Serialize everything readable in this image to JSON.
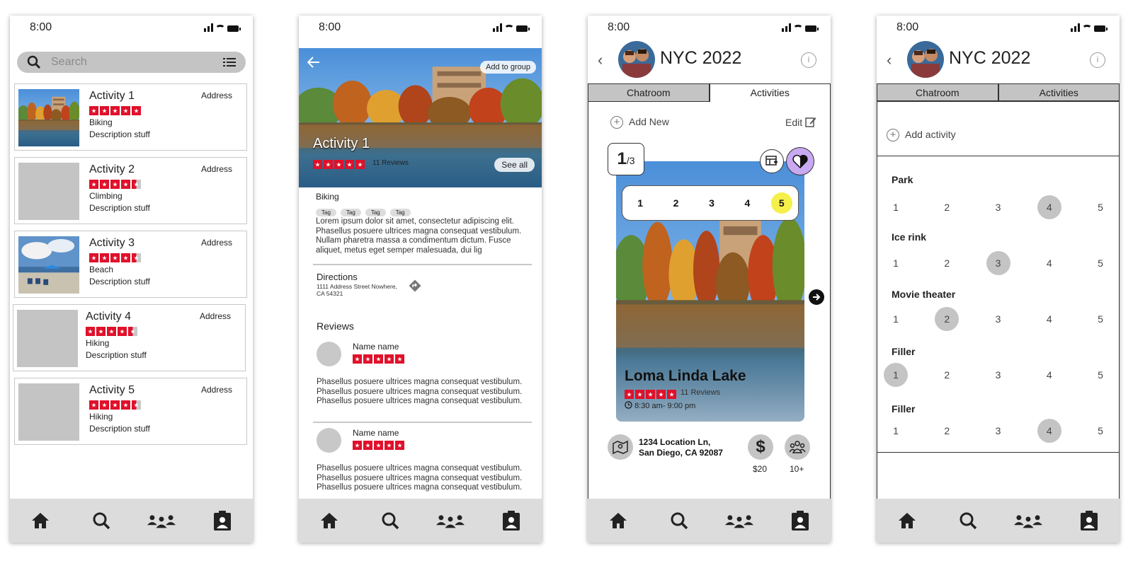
{
  "status": {
    "time": "8:00"
  },
  "search_screen": {
    "search_placeholder": "Search",
    "activities": [
      {
        "title": "Activity 1",
        "rating": 5,
        "category": "Biking",
        "description": "Description stuff",
        "address": "Address",
        "image": "lake"
      },
      {
        "title": "Activity 2",
        "rating": 4.5,
        "category": "Climbing",
        "description": "Description stuff",
        "address": "Address",
        "image": "none"
      },
      {
        "title": "Activity 3",
        "rating": 4.5,
        "category": "Beach",
        "description": "Description stuff",
        "address": "Address",
        "image": "beach"
      },
      {
        "title": "Activity 4",
        "rating": 4.5,
        "category": "Hiking",
        "description": "Description stuff",
        "address": "Address",
        "image": "none"
      },
      {
        "title": "Activity 5",
        "rating": 4.5,
        "category": "Hiking",
        "description": "Description stuff",
        "address": "Address",
        "image": "none"
      }
    ]
  },
  "detail_screen": {
    "add_to_group": "Add to group",
    "title": "Activity 1",
    "reviews_count": "11 Reviews",
    "see_all": "See all",
    "category": "Biking",
    "tags": [
      "Tag",
      "Tag",
      "Tag",
      "Tag"
    ],
    "description": "Lorem ipsum dolor sit amet, consectetur adipiscing elit. Phasellus posuere ultrices magna consequat vestibulum. Nullam pharetra massa a condimentum dictum. Fusce aliquet, metus eget semper malesuada, dui lig",
    "directions_label": "Directions",
    "address_line1": "1111 Address Street Nowhere,",
    "address_line2": "CA 54321",
    "reviews_label": "Reviews",
    "reviews": [
      {
        "name": "Name name",
        "text": "Phasellus posuere ultrices magna consequat vestibulum. Phasellus posuere ultrices magna consequat vestibulum. Phasellus posuere ultrices magna consequat vestibulum."
      },
      {
        "name": "Name name",
        "text": "Phasellus posuere ultrices magna consequat vestibulum. Phasellus posuere ultrices magna consequat vestibulum. Phasellus posuere ultrices magna consequat vestibulum."
      }
    ]
  },
  "group_screen": {
    "group_name": "NYC 2022",
    "info": "i",
    "tab_chatroom": "Chatroom",
    "tab_activities": "Activities",
    "add_new": "Add New",
    "edit": "Edit",
    "counter_current": "1",
    "counter_total": "/3",
    "rank_options": [
      "1",
      "2",
      "3",
      "4",
      "5"
    ],
    "selected_rank": "5",
    "place_name": "Loma Linda Lake",
    "place_reviews": "11 Reviews",
    "hours": "8:30 am- 9:00 pm",
    "location_line1": "1234 Location Ln,",
    "location_line2": "San Diego, CA 92087",
    "price_symbol": "$",
    "price": "$20",
    "group_size": "10+"
  },
  "ranking_screen": {
    "group_name": "NYC 2022",
    "tab_chatroom": "Chatroom",
    "tab_activities": "Activities",
    "add_activity": "Add activity",
    "categories": [
      {
        "label": "Park",
        "selected": 4
      },
      {
        "label": "Ice rink",
        "selected": 3
      },
      {
        "label": "Movie theater",
        "selected": 2
      },
      {
        "label": "Filler",
        "selected": 1
      },
      {
        "label": "Filler",
        "selected": 4
      }
    ],
    "numbers": [
      "1",
      "2",
      "3",
      "4",
      "5"
    ]
  },
  "colors": {
    "accent_red": "#e0102a",
    "highlight_yellow": "#f5ef4a",
    "heart_purple": "#c9a9f2",
    "gray": "#c4c4c4",
    "navbar": "#dcdcdc"
  },
  "icons": [
    "search-icon",
    "list-icon",
    "back-arrow-icon",
    "directions-icon",
    "home-icon",
    "group-icon",
    "clipboard-icon",
    "plus-circle-icon",
    "edit-icon",
    "menu-add-icon",
    "heart-icon",
    "next-arrow-icon",
    "clock-icon",
    "map-icon",
    "dollar-icon",
    "people-icon",
    "info-icon",
    "chevron-left-icon"
  ]
}
